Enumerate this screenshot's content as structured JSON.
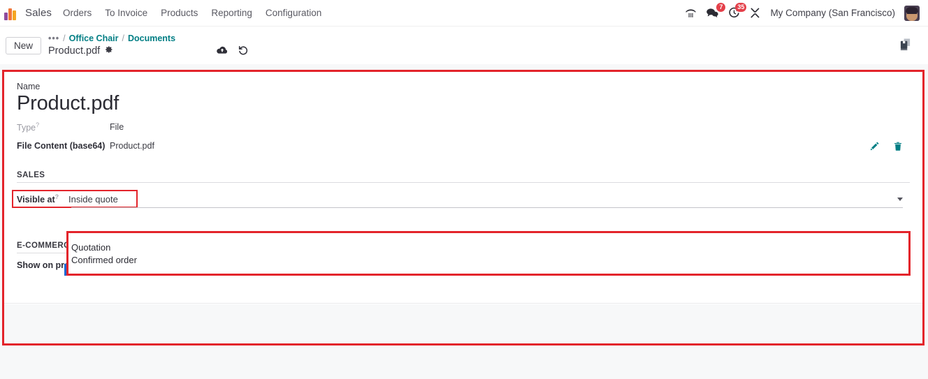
{
  "navbar": {
    "brand_icon": "odoo-logo-icon",
    "app_name": "Sales",
    "menu": [
      {
        "label": "Orders"
      },
      {
        "label": "To Invoice"
      },
      {
        "label": "Products"
      },
      {
        "label": "Reporting"
      },
      {
        "label": "Configuration"
      }
    ],
    "icons": {
      "voip": "phone-dialpad-icon",
      "messages": "chat-bubbles-icon",
      "activities": "clock-activity-icon",
      "debug": "wrench-tools-icon"
    },
    "messages_count": "7",
    "activities_count": "35",
    "company": "My Company (San Francisco)",
    "avatar": "user-avatar"
  },
  "control_panel": {
    "new_label": "New",
    "breadcrumb": {
      "dots": "•••",
      "separator": "/",
      "items": [
        {
          "label": "Office Chair"
        },
        {
          "label": "Documents"
        }
      ],
      "current": "Product.pdf",
      "settings_icon": "gear-icon"
    },
    "actions": {
      "save": "cloud-upload-icon",
      "discard": "undo-arrow-icon"
    },
    "attachment_icon": "attachment-box-icon"
  },
  "form": {
    "name_label": "Name",
    "name_value": "Product.pdf",
    "rows": [
      {
        "label": "Type",
        "help": "?",
        "value": "File",
        "muted": true
      },
      {
        "label": "File Content (base64)",
        "value": "Product.pdf",
        "muted": false
      }
    ],
    "content_actions": {
      "edit": "pencil-edit-icon",
      "delete": "trash-delete-icon"
    },
    "sales_section": {
      "title": "SALES",
      "visible_at": {
        "label": "Visible at",
        "help": "?",
        "value": "Inside quote",
        "caret": "chevron-down-icon",
        "options": [
          "Quotation",
          "Confirmed order",
          "Inside quote"
        ],
        "selected_option": "Inside quote"
      }
    },
    "ecommerce_section": {
      "title": "E-COMMERCE",
      "show_on_product_page": {
        "label": "Show on product page",
        "checked": true
      }
    }
  },
  "colors": {
    "accent_teal": "#017e84",
    "highlight_red": "#e3242b",
    "select_blue": "#1967d2",
    "badge_red": "#e4404a"
  }
}
